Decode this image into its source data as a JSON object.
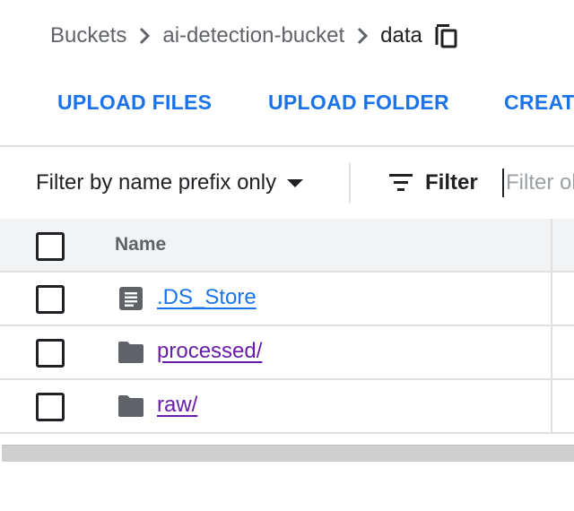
{
  "breadcrumb": {
    "items": [
      "Buckets",
      "ai-detection-bucket"
    ],
    "current": "data",
    "copy_icon": "content-copy-icon",
    "separator_icon": "chevron-right-icon"
  },
  "actions": [
    "UPLOAD FILES",
    "UPLOAD FOLDER",
    "CREAT"
  ],
  "filter": {
    "mode_label": "Filter by name prefix only",
    "button_label": "Filter",
    "input_placeholder": "Filter ol",
    "input_value": ""
  },
  "table": {
    "columns": [
      "Name"
    ],
    "rows": [
      {
        "name": ".DS_Store",
        "type": "file",
        "icon": "document-icon"
      },
      {
        "name": "processed/",
        "type": "folder",
        "icon": "folder-icon"
      },
      {
        "name": "raw/",
        "type": "folder",
        "icon": "folder-icon"
      }
    ]
  },
  "colors": {
    "accent": "#1a73e8",
    "visited_link": "#681da8",
    "header_bg": "#f1f3f4",
    "icon_gray": "#5f6368"
  }
}
